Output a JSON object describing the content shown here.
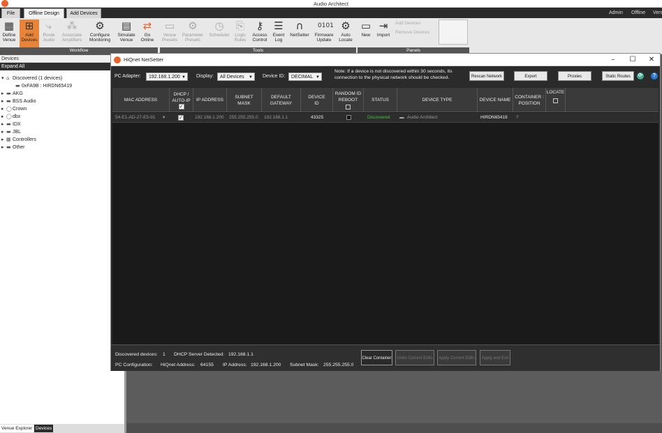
{
  "app": {
    "title": "Audio Architect"
  },
  "menu": {
    "tabs": [
      {
        "label": "File"
      },
      {
        "label": "Offline Design"
      },
      {
        "label": "Add Devices"
      }
    ],
    "right": {
      "admin": "Admin",
      "offline": "Offline",
      "ver": "Vers"
    }
  },
  "ribbon": {
    "workflow": [
      {
        "label": "Define Venue",
        "icon": "define-venue-icon"
      },
      {
        "label": "Add Devices",
        "icon": "add-devices-icon"
      },
      {
        "label": "Route Audio",
        "icon": "route-audio-icon"
      },
      {
        "label": "Associate Amplifiers",
        "icon": "amplifier-icon"
      },
      {
        "label": "Configure Monitoring",
        "icon": "monitoring-icon"
      },
      {
        "label": "Simulate Venue",
        "icon": "simulate-venue-icon"
      },
      {
        "label": "Go Online",
        "icon": "go-online-icon"
      }
    ],
    "tools": [
      {
        "label": "Venue Presets",
        "icon": "venue-presets-icon"
      },
      {
        "label": "Parameter Presets",
        "icon": "parameter-presets-icon"
      },
      {
        "label": "Scheduler",
        "icon": "clock-icon"
      },
      {
        "label": "Logic Rules",
        "icon": "logic-rules-icon"
      },
      {
        "label": "Access Control",
        "icon": "key-icon"
      },
      {
        "label": "Event Log",
        "icon": "event-log-icon"
      },
      {
        "label": "NetSetter",
        "icon": "netsetter-icon"
      },
      {
        "label": "Firmware Update",
        "icon": "firmware-icon"
      },
      {
        "label": "Auto Locate",
        "icon": "auto-locate-icon"
      }
    ],
    "panels": [
      {
        "label": "New",
        "icon": "new-panel-icon"
      },
      {
        "label": "Import",
        "icon": "import-icon"
      }
    ],
    "panels_small": [
      "Add Devices",
      "Remove Devices"
    ],
    "groups": {
      "workflow": "Workflow",
      "tools": "Tools",
      "panels": "Panels"
    }
  },
  "sidebar": {
    "header": "Devices",
    "expand_all": "Expand All",
    "tree": [
      {
        "label": "Discovered (1 devices)",
        "level": 0,
        "expanded": true
      },
      {
        "label": "0xFA9B : HIRDN65419",
        "level": 2
      },
      {
        "label": "AKG",
        "level": 0
      },
      {
        "label": "BSS Audio",
        "level": 0
      },
      {
        "label": "Crown",
        "level": 0
      },
      {
        "label": "dbx",
        "level": 0
      },
      {
        "label": "IDX",
        "level": 0
      },
      {
        "label": "JBL",
        "level": 0
      },
      {
        "label": "Controllers",
        "level": 0
      },
      {
        "label": "Other",
        "level": 0
      }
    ],
    "tabs": [
      {
        "label": "Venue Explorer"
      },
      {
        "label": "Devices"
      }
    ]
  },
  "dialog": {
    "title": "HiQnet NetSetter",
    "toolbar": {
      "pc_adapter_label": "PC Adapter:",
      "pc_adapter_value": "192.168.1.200",
      "display_label": "Display:",
      "display_value": "All Devices",
      "device_id_label": "Device ID:",
      "device_id_value": "DECIMAL",
      "note": "Note: If a device is not discovered within 30 seconds, its connection to the physical network should be checked.",
      "buttons": [
        "Rescan Network",
        "Export",
        "Proxies",
        "Static Routes"
      ]
    },
    "columns": [
      "MAC ADDRESS",
      "DHCP / AUTO-IP",
      "IP ADDRESS",
      "SUBNET MASK",
      "DEFAULT GATEWAY",
      "DEVICE ID",
      "RANDOM ID REBOOT",
      "STATUS",
      "DEVICE TYPE",
      "DEVICE NAME",
      "CONTAINER : POSITION",
      "LOCATE"
    ],
    "rows": [
      {
        "mac": "54-E1-AD-27-E5-91",
        "dhcp": true,
        "ip": "192.168.1.200",
        "subnet": "255.255.255.0",
        "gateway": "192.168.1.1",
        "device_id": "43325",
        "random_reboot": false,
        "status": "Discovered",
        "device_type": "Audio Architect",
        "device_name": "HIRDN65419",
        "container": "?"
      }
    ],
    "status": {
      "discovered_label": "Discovered devices:",
      "discovered_value": "1",
      "dhcp_label": "DHCP Server Detected:",
      "dhcp_value": "192.168.1.1",
      "pc_config_label": "PC Configuration:",
      "hiqnet_label": "HiQnet Address:",
      "hiqnet_value": "64155",
      "ip_label": "IP Address:",
      "ip_value": "192.168.1.200",
      "subnet_label": "Subnet Mask:",
      "subnet_value": "255.255.255.0"
    },
    "bottom_buttons": [
      "Clear Container",
      "Undo Current Edits",
      "Apply Current Edits",
      "Apply and Exit"
    ]
  },
  "colors": {
    "accent": "#e8843a",
    "status_discovered": "#3cc83c",
    "logo": "#e8632a"
  }
}
